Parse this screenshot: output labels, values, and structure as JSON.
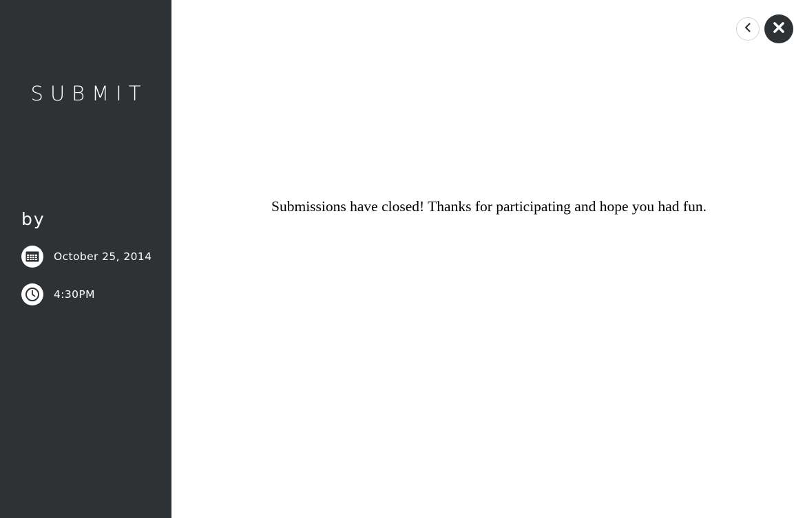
{
  "sidebar": {
    "title": "SUBMIT",
    "by_label": "by",
    "date": {
      "icon": "calendar-icon",
      "text": "October 25, 2014"
    },
    "time": {
      "icon": "clock-icon",
      "text": "4:30PM"
    }
  },
  "main": {
    "message": "Submissions have closed! Thanks for participating and hope you had fun."
  },
  "controls": {
    "back": {
      "icon": "chevron-left-icon"
    },
    "close": {
      "icon": "close-icon"
    }
  },
  "colors": {
    "sidebar_bg": "#2e3235",
    "text_light": "#ffffff",
    "main_bg": "#ffffff",
    "main_text": "#000000"
  }
}
